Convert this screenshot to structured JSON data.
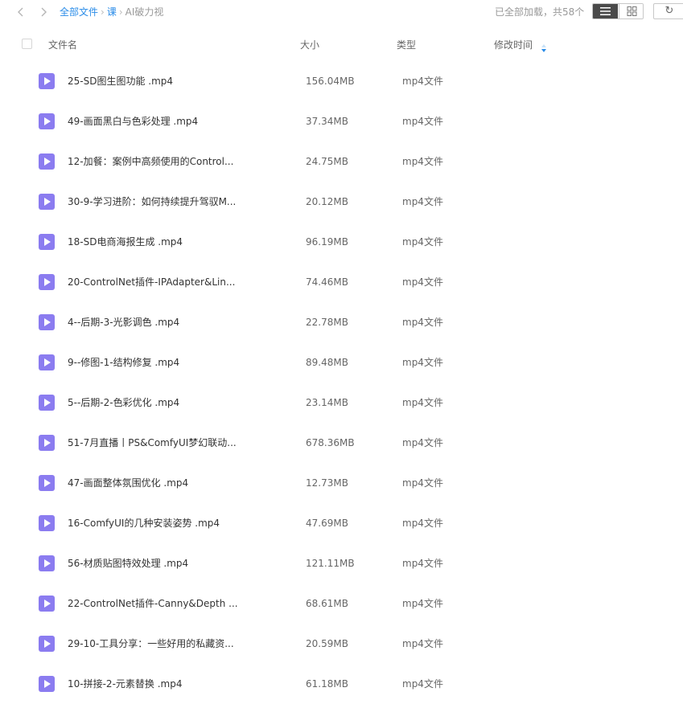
{
  "nav": {
    "back_icon": "chevron-left-icon",
    "forward_icon": "chevron-right-icon"
  },
  "breadcrumb": [
    {
      "label": "全部文件",
      "link": true
    },
    {
      "label": "课",
      "link": true
    },
    {
      "label": "AI破力视",
      "link": false
    }
  ],
  "breadcrumb_separator": "›",
  "status": {
    "loaded_text": "已全部加载，共58个"
  },
  "toolbar": {
    "list_view_icon": "list-view-icon",
    "grid_view_icon": "grid-view-icon",
    "refresh_icon": "refresh-icon",
    "refresh_glyph": "↻"
  },
  "columns": {
    "name": "文件名",
    "size": "大小",
    "type": "类型",
    "modified": "修改时间"
  },
  "colors": {
    "accent": "#2a8ce8",
    "video_icon": "#8b7cf0"
  },
  "files": [
    {
      "name": "25-SD图生图功能 .mp4",
      "size": "156.04MB",
      "type": "mp4文件"
    },
    {
      "name": "49-画面黑白与色彩处理 .mp4",
      "size": "37.34MB",
      "type": "mp4文件"
    },
    {
      "name": "12-加餐：案例中高频使用的Control...",
      "size": "24.75MB",
      "type": "mp4文件"
    },
    {
      "name": "30-9-学习进阶：如何持续提升驾驭M...",
      "size": "20.12MB",
      "type": "mp4文件"
    },
    {
      "name": "18-SD电商海报生成 .mp4",
      "size": "96.19MB",
      "type": "mp4文件"
    },
    {
      "name": "20-ControlNet插件-IPAdapter&Lin...",
      "size": "74.46MB",
      "type": "mp4文件"
    },
    {
      "name": "4--后期-3-光影调色 .mp4",
      "size": "22.78MB",
      "type": "mp4文件"
    },
    {
      "name": "9--修图-1-结构修复 .mp4",
      "size": "89.48MB",
      "type": "mp4文件"
    },
    {
      "name": "5--后期-2-色彩优化 .mp4",
      "size": "23.14MB",
      "type": "mp4文件"
    },
    {
      "name": "51-7月直播丨PS&ComfyUI梦幻联动...",
      "size": "678.36MB",
      "type": "mp4文件"
    },
    {
      "name": "47-画面整体氛围优化 .mp4",
      "size": "12.73MB",
      "type": "mp4文件"
    },
    {
      "name": "16-ComfyUI的几种安装姿势 .mp4",
      "size": "47.69MB",
      "type": "mp4文件"
    },
    {
      "name": "56-材质贴图特效处理 .mp4",
      "size": "121.11MB",
      "type": "mp4文件"
    },
    {
      "name": "22-ControlNet插件-Canny&Depth ...",
      "size": "68.61MB",
      "type": "mp4文件"
    },
    {
      "name": "29-10-工具分享：一些好用的私藏资...",
      "size": "20.59MB",
      "type": "mp4文件"
    },
    {
      "name": "10-拼接-2-元素替换 .mp4",
      "size": "61.18MB",
      "type": "mp4文件"
    }
  ]
}
